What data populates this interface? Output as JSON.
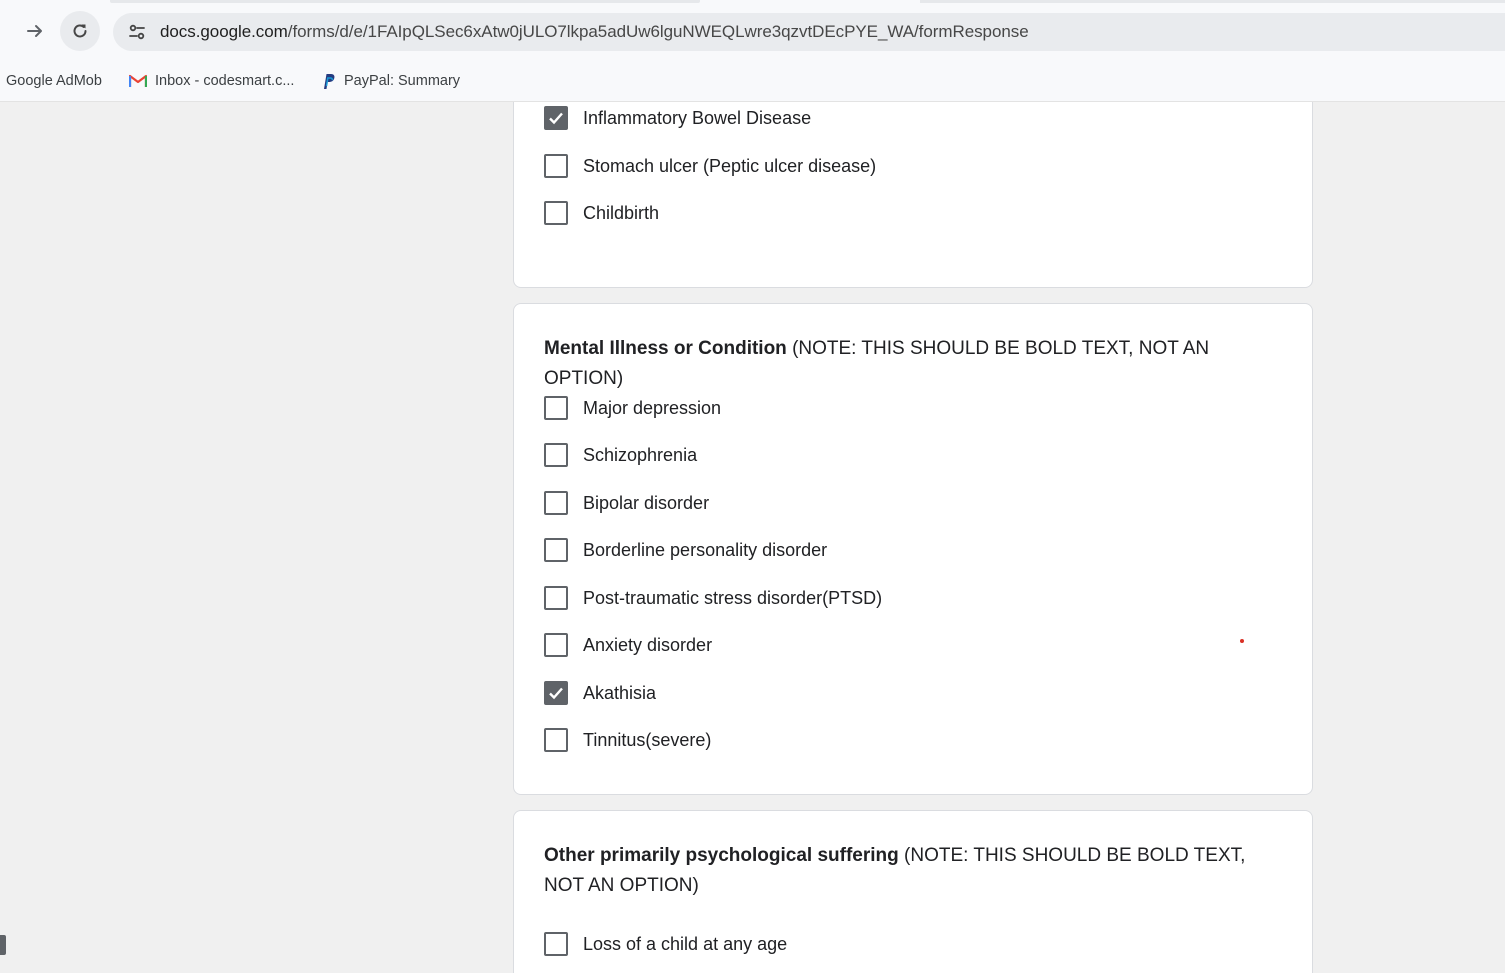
{
  "browser": {
    "url_host": "docs.google.com",
    "url_path": "/forms/d/e/1FAIpQLSec6xAtw0jULO7lkpa5adUw6lguNWEQLwre3qzvtDEcPYE_WA/formResponse",
    "bookmarks": [
      {
        "label": "Google AdMob",
        "icon": "none"
      },
      {
        "label": "Inbox - codesmart.c...",
        "icon": "gmail-icon"
      },
      {
        "label": "PayPal: Summary",
        "icon": "paypal-icon"
      }
    ]
  },
  "form": {
    "section1": {
      "options": [
        {
          "label": "Inflammatory Bowel Disease",
          "checked": true
        },
        {
          "label": "Stomach ulcer (Peptic ulcer disease)",
          "checked": false
        },
        {
          "label": "Childbirth",
          "checked": false
        }
      ]
    },
    "section2": {
      "title_bold": "Mental Illness or Condition",
      "title_rest": " (NOTE: THIS SHOULD BE BOLD TEXT, NOT AN OPTION)",
      "options": [
        {
          "label": "Major depression",
          "checked": false
        },
        {
          "label": "Schizophrenia",
          "checked": false
        },
        {
          "label": "Bipolar disorder",
          "checked": false
        },
        {
          "label": "Borderline personality disorder",
          "checked": false
        },
        {
          "label": "Post-traumatic stress disorder(PTSD)",
          "checked": false
        },
        {
          "label": "Anxiety disorder",
          "checked": false
        },
        {
          "label": "Akathisia",
          "checked": true
        },
        {
          "label": "Tinnitus(severe)",
          "checked": false
        }
      ]
    },
    "section3": {
      "title_bold": "Other primarily psychological suffering",
      "title_rest": " (NOTE: THIS SHOULD BE BOLD TEXT, NOT AN OPTION)",
      "options": [
        {
          "label": "Loss of a child at any age",
          "checked": false
        }
      ]
    }
  },
  "colors": {
    "checkbox": "#5f6368",
    "page_bg": "#f0f0f0",
    "card_border": "#dadce0"
  }
}
